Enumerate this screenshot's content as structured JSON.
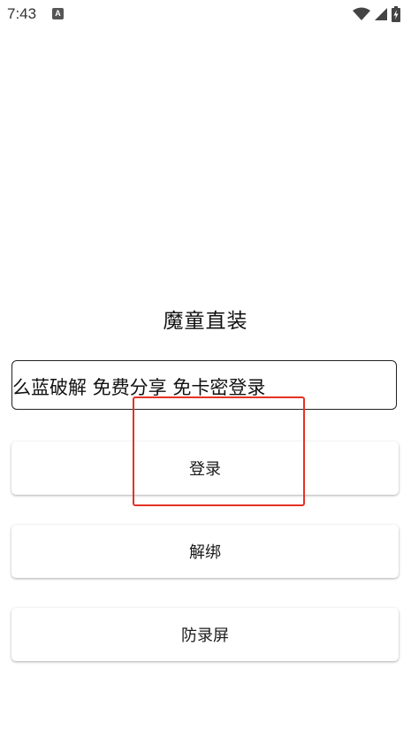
{
  "status_bar": {
    "time": "7:43",
    "notification_glyph": "A",
    "icons": [
      "wifi-icon",
      "signal-icon",
      "battery-charging-icon"
    ]
  },
  "app": {
    "title": "魔童直装"
  },
  "card_input": {
    "value": "么蓝破解 免费分享 免卡密登录"
  },
  "buttons": {
    "login_label": "登录",
    "unbind_label": "解绑",
    "anti_record_label": "防录屏"
  },
  "highlight": {
    "color": "#e53226"
  }
}
